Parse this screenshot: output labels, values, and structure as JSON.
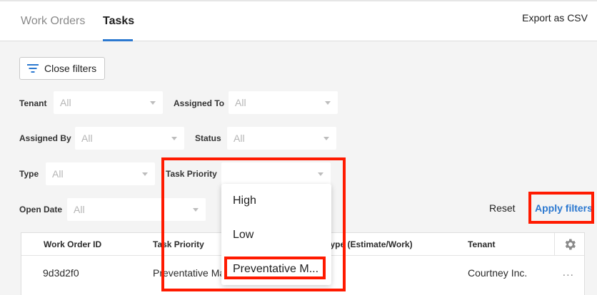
{
  "header": {
    "tabs": [
      {
        "label": "Work Orders",
        "active": false
      },
      {
        "label": "Tasks",
        "active": true
      }
    ],
    "export_label": "Export as CSV"
  },
  "filters": {
    "close_label": "Close filters",
    "tenant": {
      "label": "Tenant",
      "value": "All"
    },
    "assigned_to": {
      "label": "Assigned To",
      "value": "All"
    },
    "assigned_by": {
      "label": "Assigned By",
      "value": "All"
    },
    "status": {
      "label": "Status",
      "value": "All"
    },
    "type": {
      "label": "Type",
      "value": "All"
    },
    "task_priority": {
      "label": "Task Priority",
      "value": ""
    },
    "open_date": {
      "label": "Open Date",
      "value": "All"
    },
    "reset_label": "Reset",
    "apply_label": "Apply filters"
  },
  "dropdown": {
    "options": [
      "High",
      "Low",
      "Preventative M..."
    ]
  },
  "table": {
    "headers": [
      "Work Order ID",
      "Task Priority",
      "Type (Estimate/Work)",
      "Tenant"
    ],
    "rows": [
      {
        "id": "9d3d2f0",
        "priority": "Preventative Ma",
        "tenant": "Courtney Inc.",
        "actions": "..."
      }
    ]
  },
  "colors": {
    "accent": "#2b78d0",
    "highlight": "#ff1a00"
  }
}
